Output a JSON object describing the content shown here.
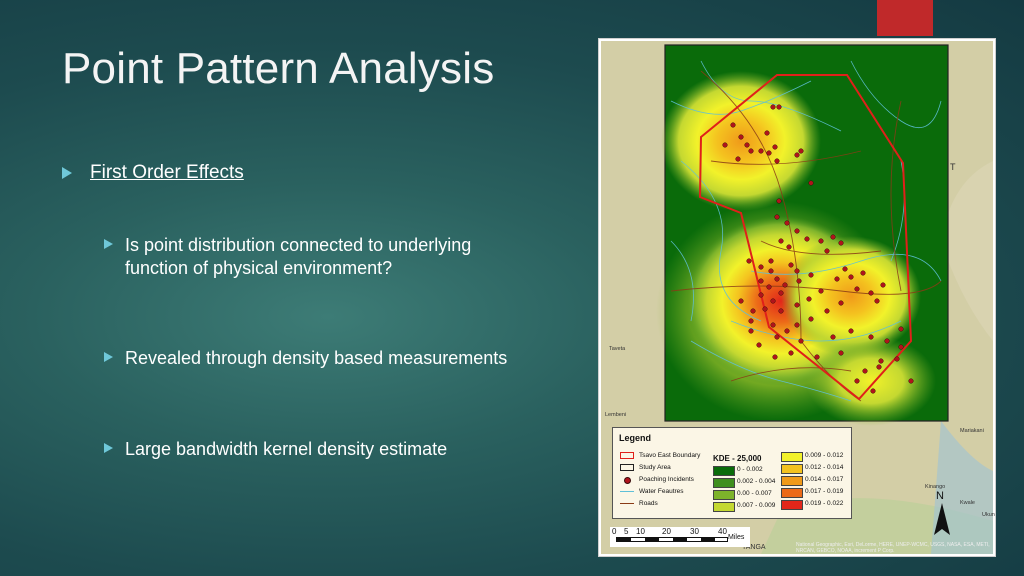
{
  "slide": {
    "title": "Point Pattern Analysis",
    "first_bullet": "First Order Effects",
    "sub_bullets": [
      "Is point distribution connected to underlying function of physical environment?",
      "Revealed through density based measurements",
      "Large bandwidth kernel density estimate"
    ],
    "accent_color": "#c0292a",
    "bullet_color": "#6fc8d9"
  },
  "map": {
    "legend": {
      "title": "Legend",
      "items": [
        "Tsavo East Boundary",
        "Study Area",
        "Poaching Incidents",
        "Water Feautres",
        "Roads"
      ],
      "kde_title": "KDE - 25,000",
      "kde_classes": [
        {
          "label": "0 - 0.002",
          "color": "#0a6b0a"
        },
        {
          "label": "0.002 - 0.004",
          "color": "#3f8f1e"
        },
        {
          "label": "0.00 - 0.007",
          "color": "#7db32b"
        },
        {
          "label": "0.007 - 0.009",
          "color": "#c4d831"
        },
        {
          "label": "0.009 - 0.012",
          "color": "#f2f22a"
        },
        {
          "label": "0.012 - 0.014",
          "color": "#f4c21f"
        },
        {
          "label": "0.014 - 0.017",
          "color": "#f09a1a"
        },
        {
          "label": "0.017 - 0.019",
          "color": "#ec6a18"
        },
        {
          "label": "0.019 - 0.022",
          "color": "#e2261a"
        }
      ]
    },
    "scale": {
      "ticks": [
        "0",
        "5",
        "10",
        "20",
        "30",
        "40"
      ],
      "unit": "Miles"
    },
    "north_label": "N",
    "places": [
      "Taveta",
      "Lembeni",
      "Mariakani",
      "Kinango",
      "Kwale",
      "Ukun",
      "TANGA",
      "T"
    ],
    "attribution": "National Geographic, Esri, DeLorme, HERE, UNEP-WCMC, USGS, NASA, ESA, METI, NRCAN, GEBCO, NOAA, increment P Corp."
  }
}
